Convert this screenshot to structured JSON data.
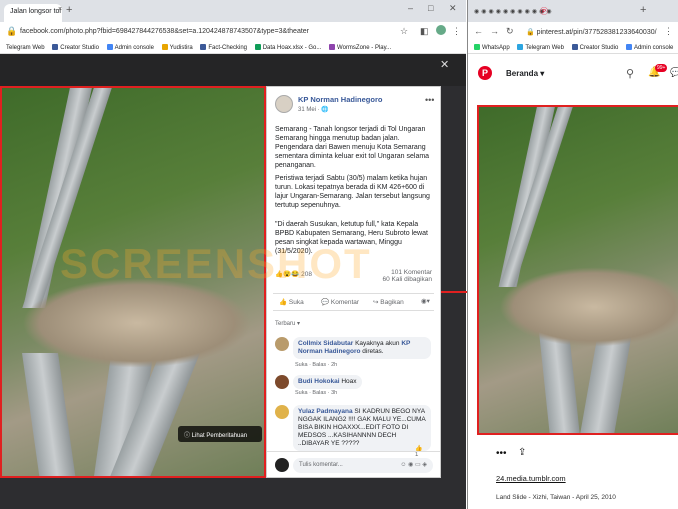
{
  "left": {
    "tab_title": "Jalan longsor tol",
    "url": "facebook.com/photo.php?fbid=698427844276538&set=a.120424878743507&type=3&theater",
    "bookmarks": [
      "Telegram Web",
      "Creator Studio",
      "Admin console",
      "Yudistira",
      "Fact-Checking",
      "Data Hoax.xlsx - Go...",
      "WormsZone - Play..."
    ],
    "post": {
      "author": "KP Norman Hadinegoro",
      "date": "31 Mei",
      "paragraph1": "Semarang - Tanah longsor terjadi di Tol Ungaran Semarang hingga menutup badan jalan. Pengendara dari Bawen menuju Kota Semarang sementara diminta keluar exit tol Ungaran selama penanganan.",
      "paragraph2": "Peristiwa terjadi Sabtu (30/5) malam ketika hujan turun. Lokasi tepatnya berada di KM 426+600 di lajur Ungaran-Semarang. Jalan tersebut langsung tertutup sepenuhnya.",
      "paragraph3": "\"Di daerah Susukan, ketutup full,\" kata Kepala BPBD Kabupaten Semarang, Heru Subroto lewat pesan singkat kepada wartawan, Minggu (31/5/2020).",
      "reactions": "208",
      "comments_count": "101 Komentar",
      "shares": "60 Kali dibagikan",
      "like": "Suka",
      "comment": "Komentar",
      "share": "Bagikan",
      "sort": "Terbaru",
      "comments": [
        {
          "name": "Collmix Sidabutar",
          "text": "Kayaknya akun",
          "link": "KP Norman Hadinegoro",
          "rest": "diretas.",
          "actions": "Suka · Balas · 2h"
        },
        {
          "name": "Budi Hokokai",
          "text": "Hoax",
          "actions": "Suka · Balas · 3h"
        },
        {
          "name": "Yulaz Padmayana",
          "text": "SI KADRUN BEGO NYA NGGAK ILANG2 !!!! GAK MALU YE...CUMA BISA BIKIN HOAXXX...EDIT FOTO DI MEDSOS ...KASIHANNNN DECH ..DIBAYAR YE ?????",
          "react_count": "1",
          "actions": "Suka · Balas · 9h"
        }
      ],
      "write_placeholder": "Tulis komentar..."
    },
    "see_caption": "Lihat Pemberitahuan",
    "watermark": "SCREENSHOT"
  },
  "right": {
    "url": "pinterest.at/pin/377528381233640030/",
    "bookmarks": [
      "WhatsApp",
      "Telegram Web",
      "Creator Studio",
      "Admin console"
    ],
    "home": "Beranda",
    "badge": "99+",
    "source": "24.media.tumblr.com",
    "caption": "Land Slide - Xizhi, Taiwan - April 25, 2010"
  },
  "colors": {
    "highlight": "#e02020",
    "fb_link": "#385898",
    "pinterest": "#e60023"
  }
}
